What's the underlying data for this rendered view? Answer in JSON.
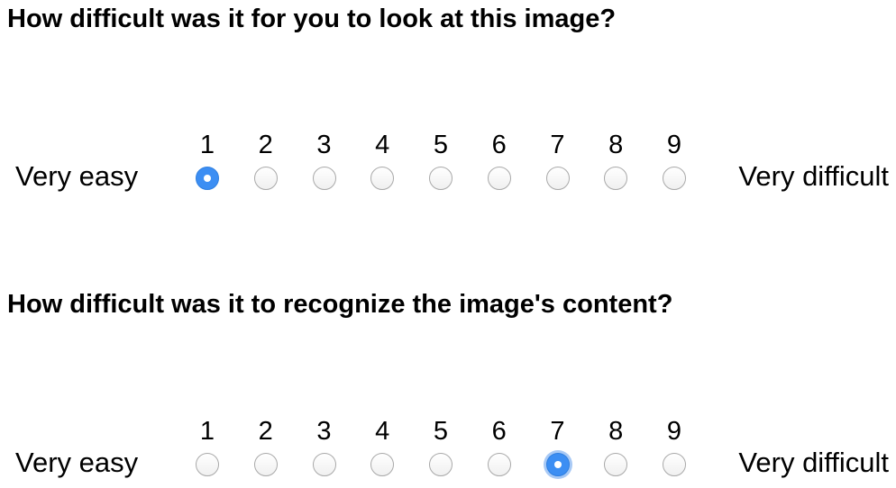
{
  "questions": [
    {
      "title": "How difficult was it for you to look at this image?",
      "low_label": "Very easy",
      "high_label": "Very difficult",
      "options": [
        "1",
        "2",
        "3",
        "4",
        "5",
        "6",
        "7",
        "8",
        "9"
      ],
      "selected": "1"
    },
    {
      "title": "How difficult was it to recognize the image's content?",
      "low_label": "Very easy",
      "high_label": "Very difficult",
      "options": [
        "1",
        "2",
        "3",
        "4",
        "5",
        "6",
        "7",
        "8",
        "9"
      ],
      "selected": "7"
    }
  ],
  "colors": {
    "radio_selected": "#3c8ef3",
    "radio_border": "#a9a9a9",
    "focus_ring": "#a8c9f5"
  }
}
